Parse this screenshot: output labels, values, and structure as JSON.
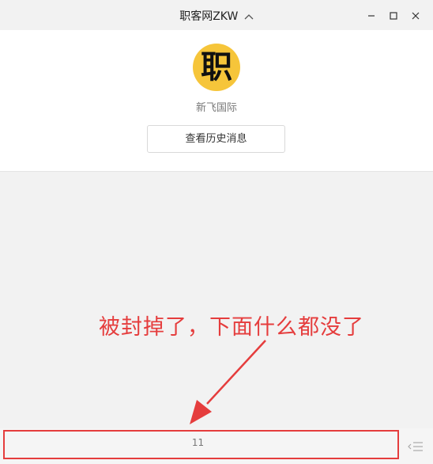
{
  "window": {
    "title": "职客网ZKW",
    "icons": [
      "chevron-up-icon",
      "minimize-icon",
      "maximize-icon",
      "close-icon"
    ]
  },
  "header": {
    "avatar_char": "职",
    "avatar_color": "#f6c53a",
    "account_name": "新飞国际",
    "history_button": "查看历史消息"
  },
  "annotation": {
    "text": "被封掉了，下面什么都没了",
    "color": "#e53d3d"
  },
  "bottom_menu": {
    "label": "11",
    "icon": "menu-list-icon"
  }
}
